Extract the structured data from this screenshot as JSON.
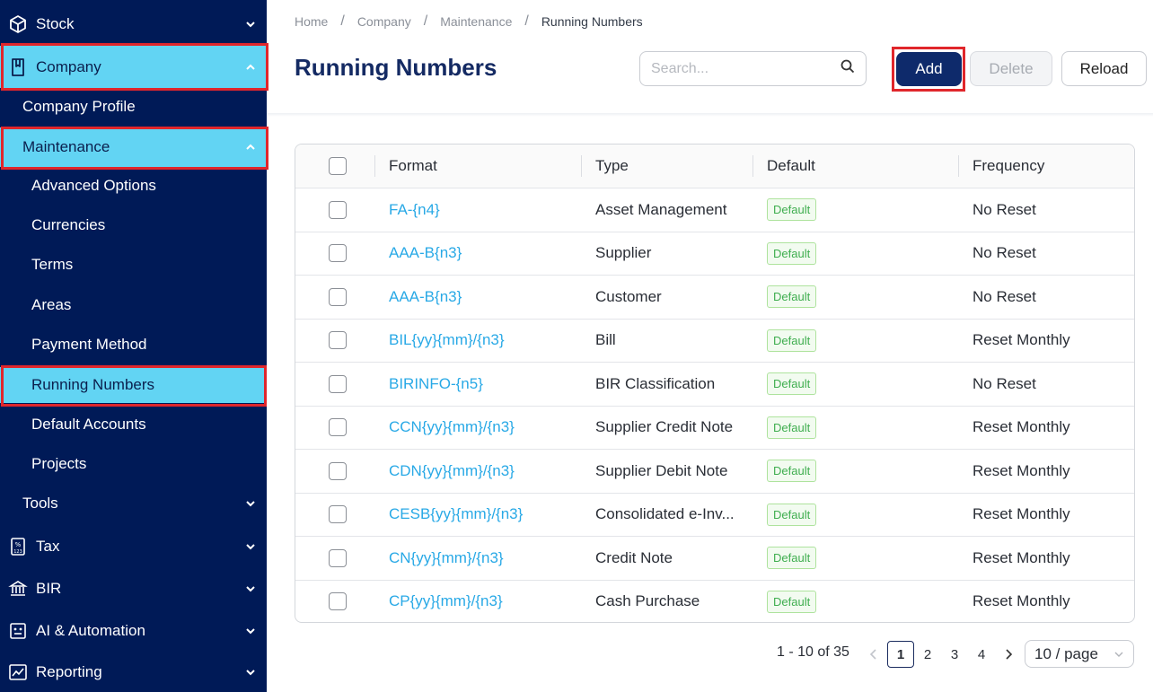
{
  "sidebar": {
    "items": [
      {
        "label": "Stock",
        "icon": "cube-icon"
      },
      {
        "label": "Company",
        "icon": "book-icon"
      },
      {
        "label": "Company Profile"
      },
      {
        "label": "Maintenance"
      },
      {
        "label": "Advanced Options"
      },
      {
        "label": "Currencies"
      },
      {
        "label": "Terms"
      },
      {
        "label": "Areas"
      },
      {
        "label": "Payment Method"
      },
      {
        "label": "Running Numbers"
      },
      {
        "label": "Default Accounts"
      },
      {
        "label": "Projects"
      },
      {
        "label": "Tools"
      },
      {
        "label": "Tax",
        "icon": "percent-icon"
      },
      {
        "label": "BIR",
        "icon": "government-icon"
      },
      {
        "label": "AI & Automation",
        "icon": "robot-icon"
      },
      {
        "label": "Reporting",
        "icon": "chart-icon"
      }
    ]
  },
  "breadcrumb": [
    "Home",
    "Company",
    "Maintenance",
    "Running Numbers"
  ],
  "header": {
    "title": "Running Numbers",
    "search_placeholder": "Search...",
    "add_label": "Add",
    "delete_label": "Delete",
    "reload_label": "Reload"
  },
  "table": {
    "columns": [
      "Format",
      "Type",
      "Default",
      "Frequency"
    ],
    "rows": [
      {
        "format": "FA-{n4}",
        "type": "Asset Management",
        "default": "Default",
        "frequency": "No Reset"
      },
      {
        "format": "AAA-B{n3}",
        "type": "Supplier",
        "default": "Default",
        "frequency": "No Reset"
      },
      {
        "format": "AAA-B{n3}",
        "type": "Customer",
        "default": "Default",
        "frequency": "No Reset"
      },
      {
        "format": "BIL{yy}{mm}/{n3}",
        "type": "Bill",
        "default": "Default",
        "frequency": "Reset Monthly"
      },
      {
        "format": "BIRINFO-{n5}",
        "type": "BIR Classification",
        "default": "Default",
        "frequency": "No Reset"
      },
      {
        "format": "CCN{yy}{mm}/{n3}",
        "type": "Supplier Credit Note",
        "default": "Default",
        "frequency": "Reset Monthly"
      },
      {
        "format": "CDN{yy}{mm}/{n3}",
        "type": "Supplier Debit Note",
        "default": "Default",
        "frequency": "Reset Monthly"
      },
      {
        "format": "CESB{yy}{mm}/{n3}",
        "type": "Consolidated e-Inv...",
        "default": "Default",
        "frequency": "Reset Monthly"
      },
      {
        "format": "CN{yy}{mm}/{n3}",
        "type": "Credit Note",
        "default": "Default",
        "frequency": "Reset Monthly"
      },
      {
        "format": "CP{yy}{mm}/{n3}",
        "type": "Cash Purchase",
        "default": "Default",
        "frequency": "Reset Monthly"
      }
    ]
  },
  "pagination": {
    "range_text": "1 - 10 of 35",
    "pages": [
      "1",
      "2",
      "3",
      "4"
    ],
    "current_page": "1",
    "page_size": "10 / page"
  },
  "colors": {
    "sidebar_bg": "#001a57",
    "active_bg": "#62d4f3",
    "highlight_border": "#e0262b",
    "primary": "#0e2a6b",
    "link": "#29a9e6",
    "badge_green": "#3fae4f"
  }
}
